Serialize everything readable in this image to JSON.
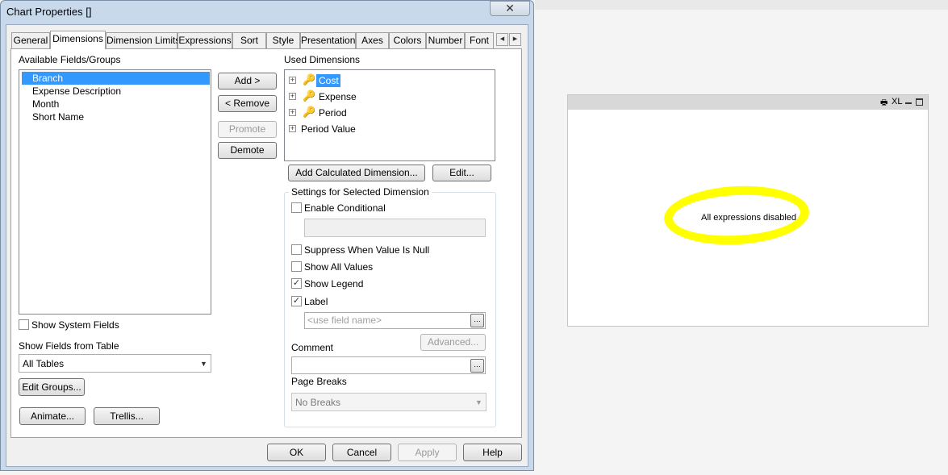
{
  "dialog": {
    "title": "Chart Properties []",
    "close_icon": "close-icon"
  },
  "tabs": [
    {
      "label": "General",
      "active": false
    },
    {
      "label": "Dimensions",
      "active": true
    },
    {
      "label": "Dimension Limits",
      "active": false
    },
    {
      "label": "Expressions",
      "active": false
    },
    {
      "label": "Sort",
      "active": false
    },
    {
      "label": "Style",
      "active": false
    },
    {
      "label": "Presentation",
      "active": false
    },
    {
      "label": "Axes",
      "active": false
    },
    {
      "label": "Colors",
      "active": false
    },
    {
      "label": "Number",
      "active": false
    },
    {
      "label": "Font",
      "active": false
    }
  ],
  "available": {
    "label": "Available Fields/Groups",
    "items": [
      "Branch",
      "Expense Description",
      "Month",
      "Short Name"
    ],
    "selected": "Branch"
  },
  "buttons": {
    "add": "Add >",
    "remove": "< Remove",
    "promote": "Promote",
    "demote": "Demote"
  },
  "used": {
    "label": "Used Dimensions",
    "items": [
      {
        "label": "Cost",
        "icon": "key-icon",
        "selected": true
      },
      {
        "label": "Expense",
        "icon": "key-icon",
        "selected": false
      },
      {
        "label": "Period",
        "icon": "key-icon",
        "selected": false
      },
      {
        "label": "Period Value",
        "icon": "",
        "selected": false
      }
    ],
    "add_calculated": "Add Calculated Dimension...",
    "edit": "Edit..."
  },
  "settings": {
    "group_label": "Settings for Selected Dimension",
    "enable_conditional": {
      "label": "Enable Conditional",
      "checked": false
    },
    "suppress_null": {
      "label": "Suppress When Value Is Null",
      "checked": false
    },
    "show_all_values": {
      "label": "Show All Values",
      "checked": false
    },
    "show_legend": {
      "label": "Show Legend",
      "checked": true
    },
    "label_check": {
      "label": "Label",
      "checked": true
    },
    "label_placeholder": "<use field name>",
    "advanced": "Advanced...",
    "comment_label": "Comment",
    "page_breaks_label": "Page Breaks",
    "page_breaks_value": "No Breaks"
  },
  "left_bottom": {
    "show_system_fields": {
      "label": "Show System Fields",
      "checked": false
    },
    "show_fields_from_table": "Show Fields from Table",
    "table_value": "All Tables",
    "edit_groups": "Edit Groups...",
    "animate": "Animate...",
    "trellis": "Trellis..."
  },
  "footer": {
    "ok": "OK",
    "cancel": "Cancel",
    "apply": "Apply",
    "help": "Help"
  },
  "chart_object": {
    "caption_xl": "XL",
    "message": "All expressions disabled",
    "highlight_color": "#ffff00"
  }
}
